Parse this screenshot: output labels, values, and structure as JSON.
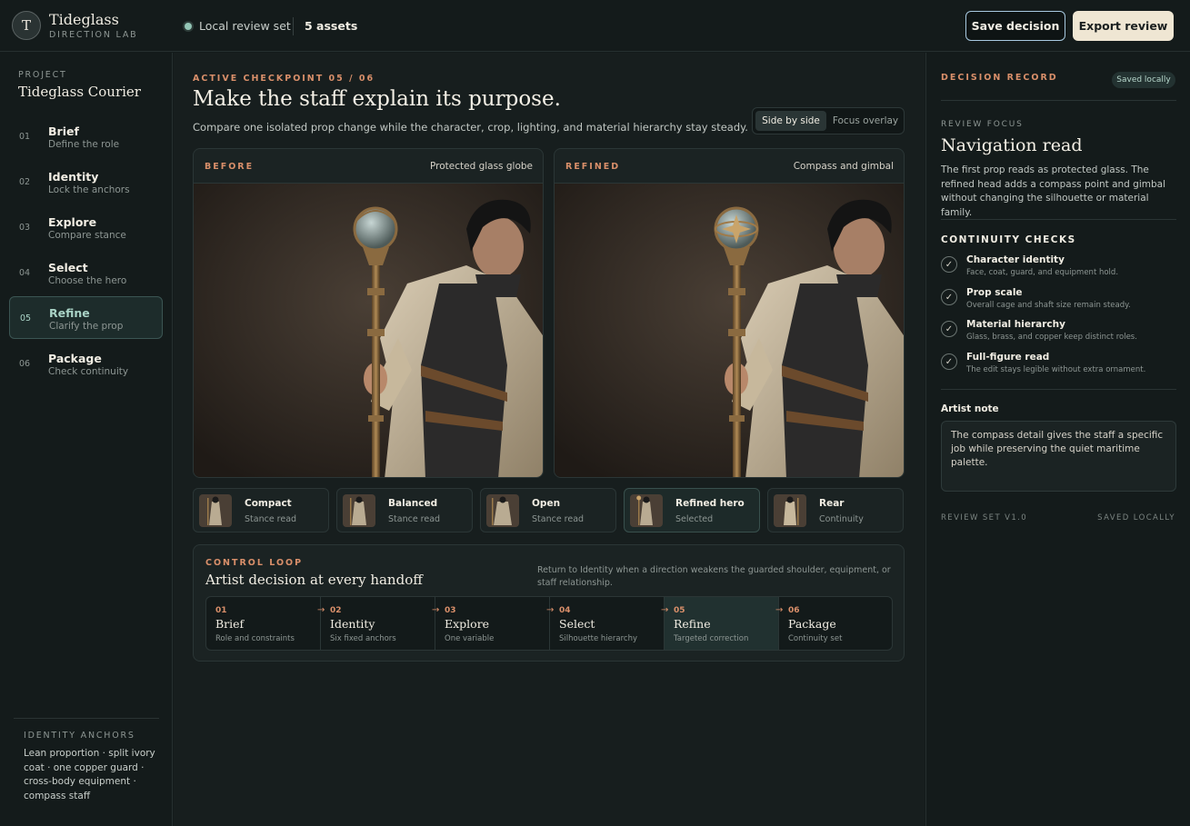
{
  "app": {
    "logo_letter": "T",
    "name": "Tideglass",
    "subtitle": "DIRECTION LAB"
  },
  "topbar": {
    "status": "Local review set",
    "asset_count": "5 assets",
    "save_label": "Save decision",
    "export_label": "Export review"
  },
  "sidebar": {
    "project_label": "PROJECT",
    "project_name": "Tideglass Courier",
    "steps": [
      {
        "num": "01",
        "title": "Brief",
        "sub": "Define the role"
      },
      {
        "num": "02",
        "title": "Identity",
        "sub": "Lock the anchors"
      },
      {
        "num": "03",
        "title": "Explore",
        "sub": "Compare stance"
      },
      {
        "num": "04",
        "title": "Select",
        "sub": "Choose the hero"
      },
      {
        "num": "05",
        "title": "Refine",
        "sub": "Clarify the prop"
      },
      {
        "num": "06",
        "title": "Package",
        "sub": "Check continuity"
      }
    ],
    "anchors_label": "IDENTITY ANCHORS",
    "anchors_text": "Lean proportion · split ivory coat · one copper guard · cross-body equipment · compass staff"
  },
  "main": {
    "checkpoint": "ACTIVE CHECKPOINT 05 / 06",
    "title": "Make the staff explain its purpose.",
    "subtitle": "Compare one isolated prop change while the character, crop, lighting, and material hierarchy stay steady.",
    "view_toggle": {
      "active": "Side by side",
      "inactive": "Focus overlay"
    },
    "before": {
      "tag": "BEFORE",
      "caption": "Protected glass globe"
    },
    "after": {
      "tag": "REFINED",
      "caption": "Compass and gimbal"
    },
    "thumbs": [
      {
        "title": "Compact",
        "sub": "Stance read"
      },
      {
        "title": "Balanced",
        "sub": "Stance read"
      },
      {
        "title": "Open",
        "sub": "Stance read"
      },
      {
        "title": "Refined hero",
        "sub": "Selected"
      },
      {
        "title": "Rear",
        "sub": "Continuity"
      }
    ],
    "loop": {
      "label": "CONTROL LOOP",
      "title": "Artist decision at every handoff",
      "note": "Return to Identity when a direction weakens the guarded shoulder, equipment, or staff relationship.",
      "steps": [
        {
          "num": "01",
          "title": "Brief",
          "sub": "Role and constraints"
        },
        {
          "num": "02",
          "title": "Identity",
          "sub": "Six fixed anchors"
        },
        {
          "num": "03",
          "title": "Explore",
          "sub": "One variable"
        },
        {
          "num": "04",
          "title": "Select",
          "sub": "Silhouette hierarchy"
        },
        {
          "num": "05",
          "title": "Refine",
          "sub": "Targeted correction"
        },
        {
          "num": "06",
          "title": "Package",
          "sub": "Continuity set"
        }
      ]
    }
  },
  "right": {
    "label": "DECISION RECORD",
    "saved_badge": "Saved locally",
    "focus_label": "REVIEW FOCUS",
    "focus_title": "Navigation read",
    "focus_text": "The first prop reads as protected glass. The refined head adds a compass point and gimbal without changing the silhouette or material family.",
    "checks_label": "CONTINUITY CHECKS",
    "checks": [
      {
        "title": "Character identity",
        "sub": "Face, coat, guard, and equipment hold."
      },
      {
        "title": "Prop scale",
        "sub": "Overall cage and shaft size remain steady."
      },
      {
        "title": "Material hierarchy",
        "sub": "Glass, brass, and copper keep distinct roles."
      },
      {
        "title": "Full-figure read",
        "sub": "The edit stays legible without extra ornament."
      }
    ],
    "note_label": "Artist note",
    "note_text": "The compass detail gives the staff a specific job while preserving the quiet maritime palette.",
    "footer_left": "REVIEW SET V1.0",
    "footer_right": "SAVED LOCALLY"
  },
  "colors": {
    "accent": "#d98f6a",
    "teal": "#93c5b5",
    "bg": "#141b1b",
    "cream": "#efe6d3"
  }
}
